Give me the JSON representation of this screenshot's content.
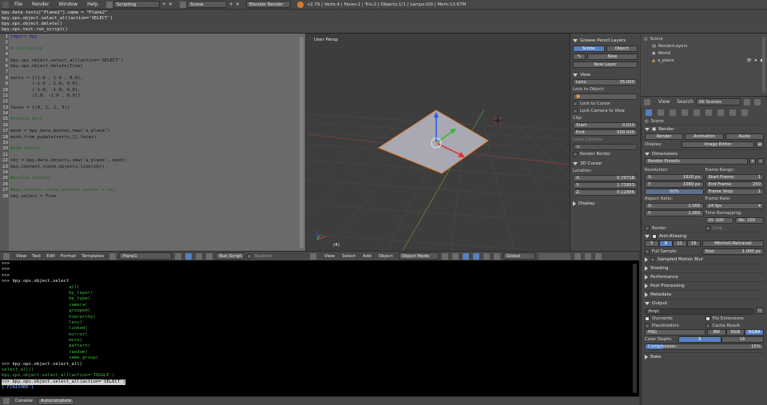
{
  "topbar": {
    "menus": [
      "File",
      "Render",
      "Window",
      "Help"
    ],
    "layout": "Scripting",
    "scene": "Scene",
    "engine": "Blender Render",
    "stats": "v2.79 | Verts:4 | Faces:1 | Tris:2 | Objects:1/1 | Lamps:0/0 | Mem:13.67M"
  },
  "info_log": [
    "bpy.data.texts[\"Plane2\"].name = \"Plane2\"",
    "bpy.ops.object.select_all(action='SELECT')",
    "bpy.ops.object.delete()",
    "bpy.ops.text.run_script()"
  ],
  "editor": {
    "lines": [
      {
        "n": "1",
        "t": "import bpy",
        "c": "kw"
      },
      {
        "n": "2",
        "t": "",
        "c": ""
      },
      {
        "n": "3",
        "t": "# initialize",
        "c": "cm"
      },
      {
        "n": "4",
        "t": "",
        "c": ""
      },
      {
        "n": "5",
        "t": "bpy.ops.object.select_all(action='SELECT')",
        "c": ""
      },
      {
        "n": "6",
        "t": "bpy.ops.object.delete(True)",
        "c": ""
      },
      {
        "n": "7",
        "t": "",
        "c": ""
      },
      {
        "n": "8",
        "t": "verts = [(1.0 , 1.0 , 0.0),",
        "c": ""
      },
      {
        "n": "9",
        "t": "        (-1.0 , 1.0, 0.0),",
        "c": ""
      },
      {
        "n": "10",
        "t": "        (-1.0, -1.0, 0.0),",
        "c": ""
      },
      {
        "n": "11",
        "t": "        (1.0, -1.0 , 0.0)]",
        "c": ""
      },
      {
        "n": "12",
        "t": "",
        "c": ""
      },
      {
        "n": "13",
        "t": "faces = [(0, 1, 2, 3)]",
        "c": ""
      },
      {
        "n": "14",
        "t": "",
        "c": ""
      },
      {
        "n": "15",
        "t": "#create mesh",
        "c": "cm"
      },
      {
        "n": "16",
        "t": "",
        "c": ""
      },
      {
        "n": "17",
        "t": "mesh = bpy.data.meshes.new('a_plane')",
        "c": ""
      },
      {
        "n": "18",
        "t": "mesh.from_pydata(verts,[],faces)",
        "c": ""
      },
      {
        "n": "19",
        "t": "",
        "c": ""
      },
      {
        "n": "20",
        "t": "#add object",
        "c": "cm"
      },
      {
        "n": "21",
        "t": "",
        "c": ""
      },
      {
        "n": "22",
        "t": "obj = bpy.data.objects.new('a_plane', mesh)",
        "c": ""
      },
      {
        "n": "23",
        "t": "bpy.context.scene.objects.link(obj)",
        "c": ""
      },
      {
        "n": "24",
        "t": "",
        "c": ""
      },
      {
        "n": "25",
        "t": "#active selects",
        "c": "cm"
      },
      {
        "n": "26",
        "t": "",
        "c": ""
      },
      {
        "n": "27",
        "t": "#bpy.context.scene.objects.active = obj",
        "c": "cm"
      },
      {
        "n": "28",
        "t": "obj.select = True",
        "c": ""
      }
    ],
    "header": {
      "menus": [
        "View",
        "Text",
        "Edit",
        "Format",
        "Templates"
      ],
      "text_name": "Plane1",
      "run_script": "Run Script",
      "register": "Register"
    }
  },
  "console": {
    "lines": [
      {
        "t": ">>>",
        "c": "c-in"
      },
      {
        "t": ">>>",
        "c": "c-in"
      },
      {
        "t": ">>>",
        "c": "c-in"
      },
      {
        "t": ">>> bpy.ops.object.select",
        "c": "c-in"
      },
      {
        "t": "                         all(",
        "c": "c-out"
      },
      {
        "t": "                         by_layer(",
        "c": "c-out"
      },
      {
        "t": "                         by_type(",
        "c": "c-out"
      },
      {
        "t": "                         camera(",
        "c": "c-out"
      },
      {
        "t": "                         grouped(",
        "c": "c-out"
      },
      {
        "t": "                         hierarchy(",
        "c": "c-out"
      },
      {
        "t": "                         less(",
        "c": "c-out"
      },
      {
        "t": "                         linked(",
        "c": "c-out"
      },
      {
        "t": "                         mirror(",
        "c": "c-out"
      },
      {
        "t": "                         more(",
        "c": "c-out"
      },
      {
        "t": "                         pattern(",
        "c": "c-out"
      },
      {
        "t": "                         random(",
        "c": "c-out"
      },
      {
        "t": "                         same_group(",
        "c": "c-out"
      },
      {
        "t": ">>> bpy.ops.object.select_all(",
        "c": "c-in"
      },
      {
        "t": "select_all()",
        "c": "c-out"
      },
      {
        "t": "bpy.ops.object.select_all(action='TOGGLE')",
        "c": "c-out"
      },
      {
        "t": ">>> bpy.ops.object.select_all(action='SELECT')",
        "c": "c-sel"
      },
      {
        "t": "{'FINISHED'}",
        "c": "c-info"
      },
      {
        "t": "",
        "c": "c-in"
      },
      {
        "t": "",
        "c": "c-in"
      },
      {
        "t": "",
        "c": "c-in"
      },
      {
        "t": ">>> ",
        "c": "c-in"
      }
    ],
    "tabs": [
      "Console",
      "Autocomplete"
    ]
  },
  "viewport": {
    "label": "User Persp",
    "frame": "(4)",
    "header": {
      "menus": [
        "View",
        "Select",
        "Add",
        "Object"
      ],
      "mode": "Object Mode",
      "orientation": "Global"
    }
  },
  "npanel": {
    "grease_pencil": "Grease Pencil Layers",
    "scene_btn": "Scene",
    "object_btn": "Object",
    "new": "New",
    "new_layer": "New Layer",
    "view": "View",
    "lens_label": "Lens:",
    "lens": "35.000",
    "lock_to_object": "Lock to Object:",
    "lock_to_cursor": "Lock to Cursor",
    "lock_camera": "Lock Camera to View",
    "clip": "Clip:",
    "start_label": "Start:",
    "start": "0.010",
    "end_label": "End:",
    "end": "500.000",
    "local_camera": "Local Camera:",
    "render_border": "Render Border",
    "cursor": "3D Cursor",
    "location": "Location:",
    "x_label": "X:",
    "x": "0.70718",
    "y_label": "Y:",
    "y": "1.73953",
    "z_label": "Z:",
    "z": "0.12886",
    "display": "Display"
  },
  "outliner": {
    "items": [
      "Scene",
      "RenderLayers",
      "World",
      "a_plane"
    ],
    "header": {
      "menus": [
        "View",
        "Search"
      ],
      "filter": "All Scenes"
    }
  },
  "props": {
    "scene": "Scene",
    "render": "Render",
    "render_btn": "Render",
    "animation_btn": "Animation",
    "audio_btn": "Audio",
    "display_label": "Display:",
    "display_val": "Image Editor",
    "dimensions": "Dimensions",
    "render_presets": "Render Presets",
    "resolution": "Resolution:",
    "res_x_label": "X:",
    "res_x": "1920 px",
    "res_y_label": "Y:",
    "res_y": "1080 px",
    "res_pct": "50%",
    "frame_range": "Frame Range:",
    "start_frame_label": "Start Frame:",
    "start_frame": "1",
    "end_frame_label": "End Frame:",
    "end_frame": "250",
    "frame_step_label": "Frame Step:",
    "frame_step": "1",
    "aspect_ratio": "Aspect Ratio:",
    "asp_x_label": "X:",
    "asp_x": "1.000",
    "asp_y_label": "Y:",
    "asp_y": "1.000",
    "frame_rate": "Frame Rate:",
    "fps": "24 fps",
    "time_remapping": "Time Remapping:",
    "old": "Ol: 100",
    "new": "Ne: 100",
    "border": "Border",
    "crop": "Crop",
    "anti_aliasing": "Anti-Aliasing",
    "aa_samples": [
      "5",
      "8",
      "11",
      "16"
    ],
    "aa_filter": "Mitchell-Netravali",
    "full_sample": "Full Sample",
    "size_label": "Size:",
    "size": "1.000 px",
    "sampled_motion_blur": "Sampled Motion Blur",
    "shading": "Shading",
    "performance": "Performance",
    "post_processing": "Post Processing",
    "metadata": "Metadata",
    "output": "Output",
    "output_path": "/tmp\\",
    "overwrite": "Overwrite",
    "file_extensions": "File Extensions",
    "placeholders": "Placeholders",
    "cache_result": "Cache Result",
    "format": "PNG",
    "bw": "BW",
    "rgb": "RGB",
    "rgba": "RGBA",
    "color_depth": "Color Depth:",
    "depth_8": "8",
    "depth_16": "16",
    "compression_label": "Compression:",
    "compression": "15%",
    "bake": "Bake"
  }
}
